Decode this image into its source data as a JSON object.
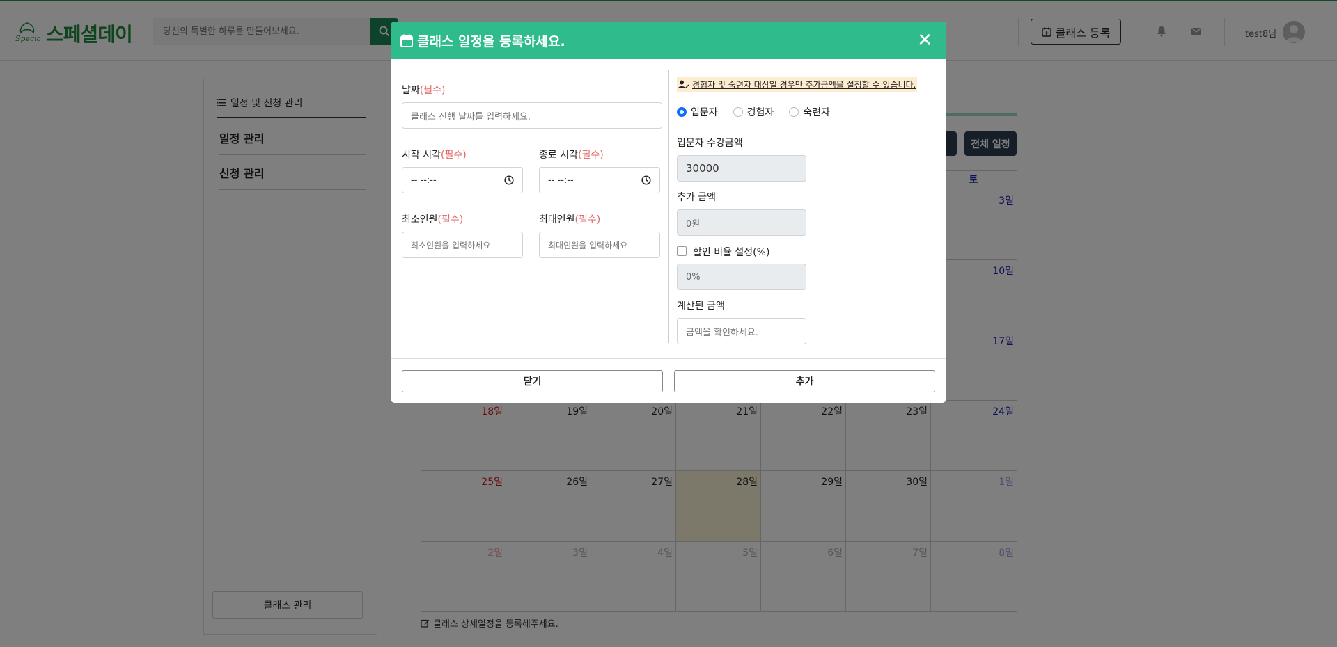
{
  "header": {
    "logo_text": "스페셜데이",
    "logo_mark_text": "Special",
    "search_placeholder": "당신의 특별한 하루를 만들어보세요.",
    "class_register_label": "클래스 등록",
    "user_name": "test8님"
  },
  "sidebar": {
    "title": "일정 및 신청 관리",
    "items": [
      {
        "label": "일정 관리"
      },
      {
        "label": "신청 관리"
      }
    ],
    "manage_button": "클래스 관리"
  },
  "calendar": {
    "all_schedule_button": "전체 일정",
    "saturday_header": "토",
    "note": "클래스 상세일정을 등록해주세요.",
    "rows": [
      [
        "",
        "",
        "",
        "",
        "",
        "",
        "3일"
      ],
      [
        "",
        "",
        "",
        "",
        "",
        "",
        "10일"
      ],
      [
        "",
        "",
        "",
        "",
        "",
        "",
        "17일"
      ],
      [
        "18일",
        "19일",
        "20일",
        "21일",
        "22일",
        "23일",
        "24일"
      ],
      [
        "25일",
        "26일",
        "27일",
        "28일",
        "29일",
        "30일",
        "1일"
      ],
      [
        "2일",
        "3일",
        "4일",
        "5일",
        "6일",
        "7일",
        "8일"
      ]
    ],
    "today": "28일",
    "colors": {
      "sunday": "#d11a1a",
      "saturday": "#1a1ab0",
      "other_month": "#aaaaaa",
      "today_bg": "#fbf3d4"
    }
  },
  "modal": {
    "title": "클래스 일정을 등록하세요.",
    "close_symbol": "✕",
    "required_mark": "(필수)",
    "date_label": "날짜",
    "date_placeholder": "클래스 진행 날짜를 입력하세요.",
    "start_time_label": "시작 시각",
    "end_time_label": "종료 시각",
    "time_value": "-- --:--",
    "min_people_label": "최소인원",
    "min_people_placeholder": "최소인원을 입력하세요",
    "max_people_label": "최대인원",
    "max_people_placeholder": "최대인원을 입력하세요",
    "notice": "경험자 및 숙련자 대상일 경우만 추가금액을 설정할 수 있습니다.",
    "levels": [
      {
        "label": "입문자",
        "selected": true
      },
      {
        "label": "경험자",
        "selected": false
      },
      {
        "label": "숙련자",
        "selected": false
      }
    ],
    "base_price_label": "입문자 수강금액",
    "base_price_value": "30000",
    "extra_label": "추가 금액",
    "extra_placeholder": "0원",
    "discount_label": "할인 비율 설정(%)",
    "discount_checked": false,
    "discount_placeholder": "0%",
    "calc_label": "계산된 금액",
    "calc_placeholder": "금액을 확인하세요.",
    "close_button": "닫기",
    "add_button": "추가",
    "header_color": "#2fbb8c"
  }
}
